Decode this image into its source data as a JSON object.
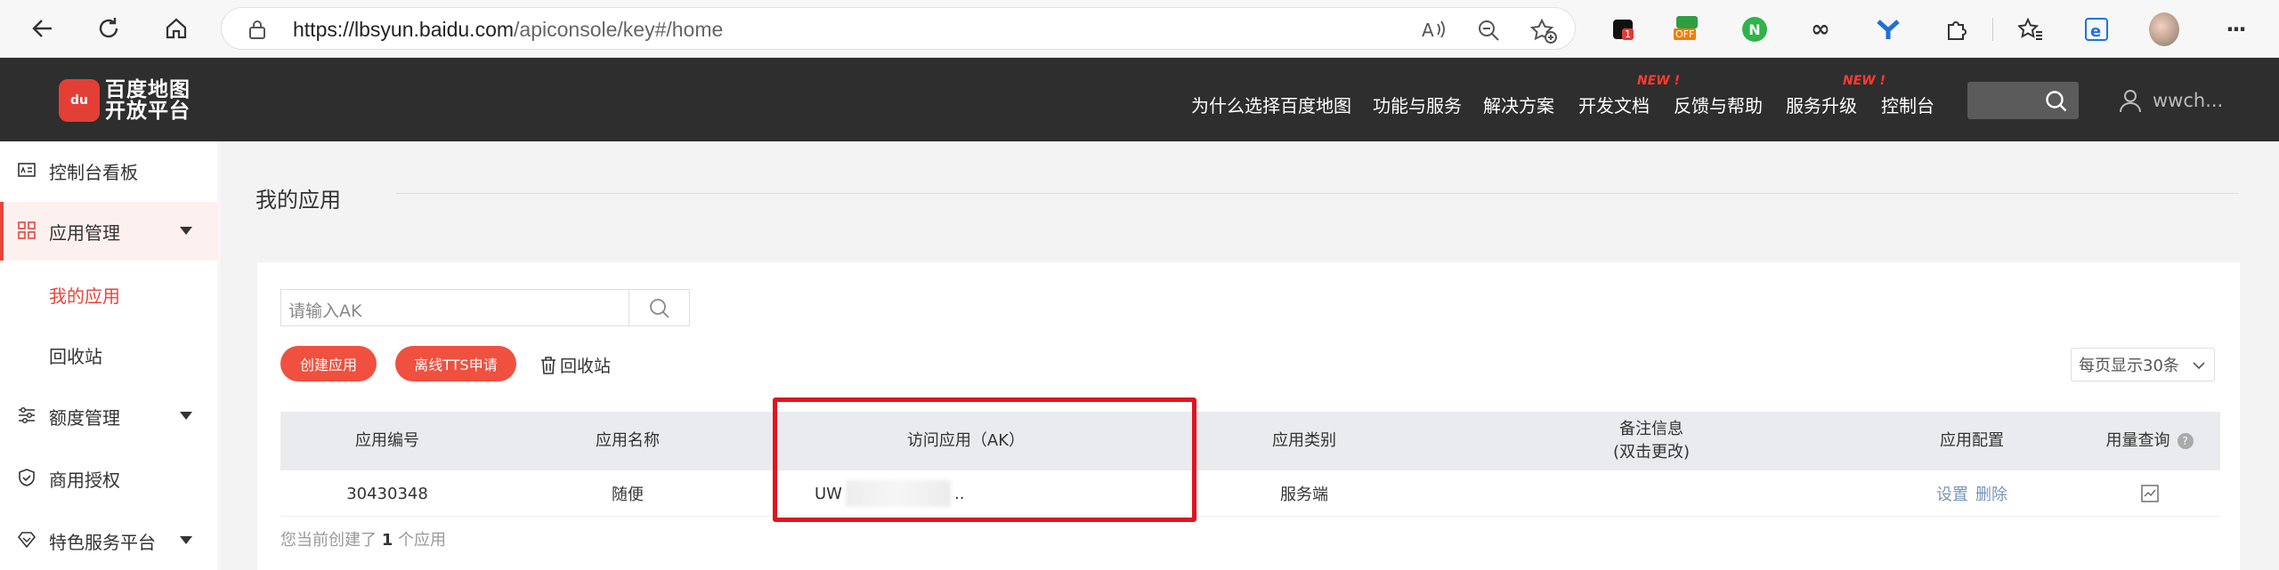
{
  "browser": {
    "url_host": "https://lbsyun.baidu.com",
    "url_path": "/apiconsole/key#/home",
    "extensions": [
      {
        "icon": "extension-black-icon",
        "badge": "1"
      },
      {
        "icon": "extension-off-icon",
        "badge": "OFF"
      },
      {
        "icon": "extension-n-icon",
        "badge": ""
      },
      {
        "icon": "infinity-icon",
        "badge": ""
      },
      {
        "icon": "y-extension-icon",
        "badge": ""
      },
      {
        "icon": "puzzle-icon",
        "badge": ""
      },
      {
        "icon": "favorites-icon",
        "badge": ""
      },
      {
        "icon": "edge-icon",
        "badge": ""
      },
      {
        "icon": "profile-avatar-icon",
        "badge": ""
      },
      {
        "icon": "more-icon",
        "badge": "···"
      }
    ]
  },
  "header": {
    "logo_line1": "百度地图",
    "logo_line2": "开放平台",
    "logo_mark": "du",
    "nav": [
      {
        "label": "为什么选择百度地图",
        "new": ""
      },
      {
        "label": "功能与服务",
        "new": ""
      },
      {
        "label": "解决方案",
        "new": ""
      },
      {
        "label": "开发文档",
        "new": "NEW !"
      },
      {
        "label": "反馈与帮助",
        "new": ""
      },
      {
        "label": "服务升级",
        "new": "NEW !"
      },
      {
        "label": "控制台",
        "new": ""
      }
    ],
    "username": "wwch..."
  },
  "sidebar": {
    "items": [
      {
        "label": "控制台看板"
      },
      {
        "label": "应用管理"
      },
      {
        "label": "我的应用"
      },
      {
        "label": "回收站"
      },
      {
        "label": "额度管理"
      },
      {
        "label": "商用授权"
      },
      {
        "label": "特色服务平台"
      }
    ]
  },
  "main": {
    "title": "我的应用",
    "search_placeholder": "请输入AK",
    "create_btn": "创建应用",
    "tts_btn": "离线TTS申请",
    "recycle_label": "回收站",
    "perpage": "每页显示30条",
    "columns": [
      "应用编号",
      "应用名称",
      "访问应用（AK）",
      "应用类别",
      "备注信息",
      "(双击更改)",
      "应用配置",
      "用量查询"
    ],
    "row": {
      "id": "30430348",
      "name": "随便",
      "ak_prefix": "UW",
      "ak_suffix": "..",
      "category": "服务端",
      "remark": "",
      "settings": "设置",
      "delete": "删除"
    },
    "footnote_pre": "您当前创建了",
    "footnote_count": "1",
    "footnote_post": "个应用"
  },
  "colors": {
    "accent": "#e8453c",
    "header_bg": "#2e2e2e",
    "button_red": "#f0503f",
    "highlight_box": "#e0141f"
  }
}
